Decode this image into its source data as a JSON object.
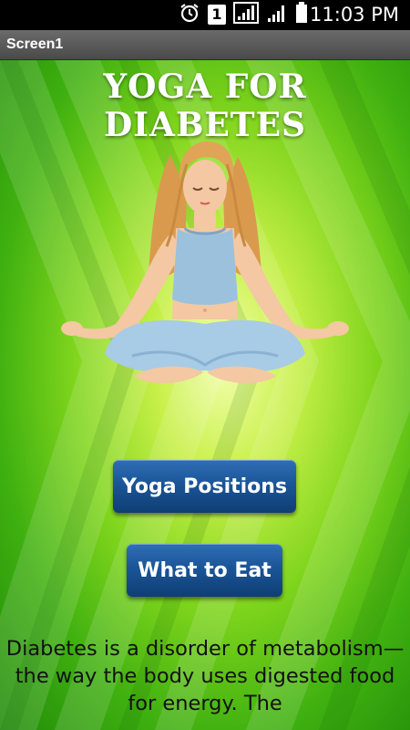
{
  "status_bar": {
    "time": "11:03 PM",
    "notification_badge": "1",
    "icons": [
      "alarm-icon",
      "notification-badge",
      "signal-box-icon",
      "cell-signal-icon",
      "battery-icon"
    ]
  },
  "titlebar": {
    "title": "Screen1"
  },
  "main": {
    "app_title": "YOGA FOR DIABETES",
    "buttons": {
      "yoga_positions": "Yoga Positions",
      "what_to_eat": "What to Eat"
    },
    "description": "Diabetes is a disorder of metabolism—the way the body uses digested food for energy. The"
  },
  "colors": {
    "background_green": "#7ed41c",
    "button_blue": "#1b5597",
    "titlebar_gray": "#5a5a5a"
  }
}
